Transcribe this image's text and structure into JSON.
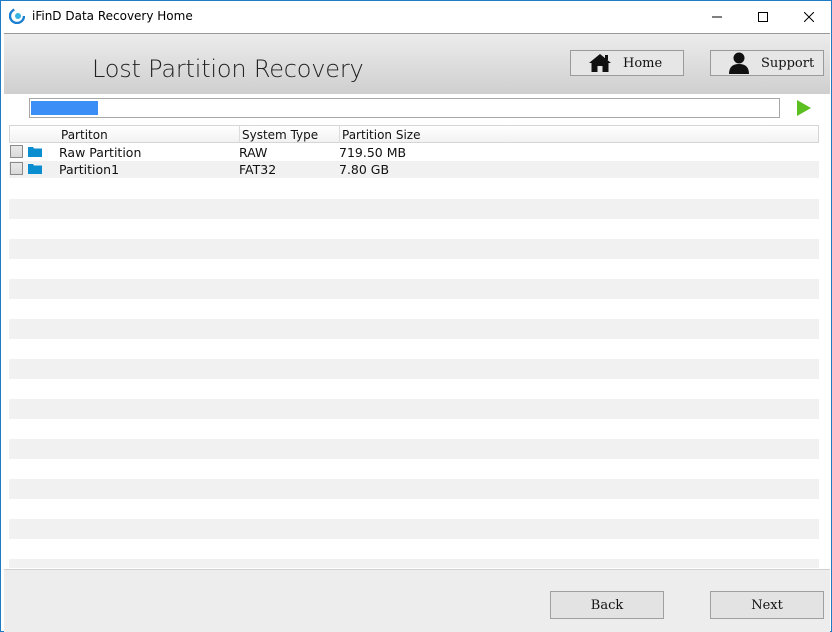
{
  "window": {
    "title": "iFinD Data Recovery Home",
    "controls": {
      "minimize": "minimize",
      "maximize": "maximize",
      "close": "close"
    }
  },
  "header": {
    "title": "Lost Partition Recovery",
    "home_label": "Home",
    "support_label": "Support"
  },
  "scan": {
    "progress_fraction": 0.09,
    "progress_color": "#3a8ef6",
    "play_color": "#5cbf20"
  },
  "table": {
    "columns": [
      "Partiton",
      "System Type",
      "Partition Size"
    ],
    "rows": [
      {
        "name": "Raw Partition",
        "type": "RAW",
        "size": "719.50 MB",
        "checked": false
      },
      {
        "name": "Partition1",
        "type": "FAT32",
        "size": "7.80 GB",
        "checked": false
      }
    ]
  },
  "footer": {
    "back_label": "Back",
    "next_label": "Next"
  }
}
